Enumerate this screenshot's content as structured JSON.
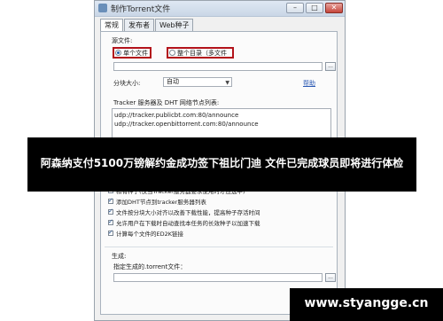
{
  "window": {
    "title": "制作Torrent文件",
    "buttons": {
      "minimize": "–",
      "maximize": "□",
      "close": "✕"
    }
  },
  "tabs": [
    "常规",
    "发布者",
    "Web种子"
  ],
  "source": {
    "label": "源文件:",
    "options": [
      {
        "label": "单个文件",
        "checked": true
      },
      {
        "label": "整个目录（多文件",
        "checked": false
      }
    ],
    "path_value": "",
    "browse_label": "..."
  },
  "chunk": {
    "label": "分块大小:",
    "selected": "自动",
    "help_link": "帮助"
  },
  "tracker": {
    "label": "Tracker 服务器及 DHT 网络节点列表:",
    "lines": [
      "udp://tracker.publicbt.com:80/announce",
      "udp://tracker.openbittorrent.com:80/announce"
    ]
  },
  "options": [
    {
      "label": "私有种子(仅当Tracker服务器要求使用时才应选中)",
      "checked": false
    },
    {
      "label": "添加DHT节点到tracker服务器列表",
      "checked": true
    },
    {
      "label": "文件按分块大小对齐以改善下载性能，提高种子存活时间",
      "checked": true
    },
    {
      "label": "允许用户在下载时自动查找本任务的长效种子以加速下载",
      "checked": true
    },
    {
      "label": "计算每个文件的ED2K链接",
      "checked": true
    }
  ],
  "generate": {
    "label": "生成:",
    "target_label": "指定生成的.torrent文件：",
    "path_value": "",
    "browse_label": "..."
  },
  "banner": {
    "text": "阿森纳支付5100万镑解约金成功签下祖比门迪 文件已完成球员即将进行体检"
  },
  "watermark": {
    "text": "www.styangge.cn"
  }
}
